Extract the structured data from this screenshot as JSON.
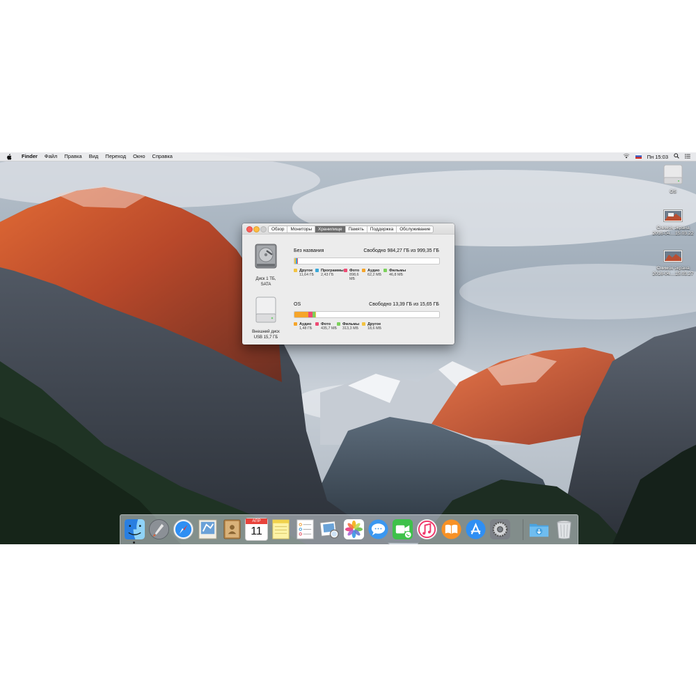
{
  "menubar": {
    "app": "Finder",
    "items": [
      "Файл",
      "Правка",
      "Вид",
      "Переход",
      "Окно",
      "Справка"
    ],
    "clock": "Пн 15:03"
  },
  "desktop_items": [
    {
      "label_line1": "OS",
      "label_line2": ""
    },
    {
      "label_line1": "Снимок экрана",
      "label_line2": "2016-04....15.03.22"
    },
    {
      "label_line1": "Снимок экрана",
      "label_line2": "2016-04....15.03.27"
    }
  ],
  "window": {
    "tabs": [
      "Обзор",
      "Мониторы",
      "Хранилище",
      "Память",
      "Поддержка",
      "Обслуживание"
    ],
    "active_tab": "Хранилище",
    "disks": [
      {
        "caption_line1": "Диск 1 ТБ,",
        "caption_line2": "SATA",
        "name": "Без названия",
        "free": "Свободно 984,27 ГБ из 999,35 ГБ",
        "used_fraction": 0.015,
        "segments": [
          {
            "color": "#f3c340",
            "fraction": 0.0117
          },
          {
            "color": "#39a8d9",
            "fraction": 0.0024
          },
          {
            "color": "#ee4a73",
            "fraction": 0.0009
          }
        ],
        "legend": [
          {
            "label": "Другое",
            "value": "11,64 ГБ",
            "color": "#f3c340"
          },
          {
            "label": "Программы",
            "value": "2,43 ГБ",
            "color": "#39a8d9"
          },
          {
            "label": "Фото",
            "value": "898,6 МБ",
            "color": "#ee4a73"
          },
          {
            "label": "Аудио",
            "value": "62,2 МБ",
            "color": "#f6a52a"
          },
          {
            "label": "Фильмы",
            "value": "46,8 МБ",
            "color": "#7cd05b"
          }
        ]
      },
      {
        "caption_line1": "Внешний диск",
        "caption_line2": "USB 15,7 ГБ",
        "name": "OS",
        "free": "Свободно 13,39 ГБ из 15,65 ГБ",
        "segments": [
          {
            "color": "#f6a52a",
            "fraction": 0.095
          },
          {
            "color": "#ee4a73",
            "fraction": 0.028
          },
          {
            "color": "#7cd05b",
            "fraction": 0.02
          },
          {
            "color": "#f3c340",
            "fraction": 0.001
          }
        ],
        "legend": [
          {
            "label": "Аудио",
            "value": "1,48 ГБ",
            "color": "#f6a52a"
          },
          {
            "label": "Фото",
            "value": "435,7 МБ",
            "color": "#ee4a73"
          },
          {
            "label": "Фильмы",
            "value": "313,3 МБ",
            "color": "#7cd05b"
          },
          {
            "label": "Другое",
            "value": "18,6 МБ",
            "color": "#f3c340"
          }
        ]
      }
    ]
  },
  "dock": {
    "calendar_month": "АПР",
    "calendar_day": "11",
    "apps": [
      "finder",
      "launchpad",
      "safari",
      "mail",
      "contacts",
      "calendar",
      "notes",
      "reminders",
      "preview",
      "photos",
      "messages",
      "facetime",
      "itunes",
      "ibooks",
      "app-store",
      "system-preferences",
      "downloads",
      "trash"
    ]
  }
}
